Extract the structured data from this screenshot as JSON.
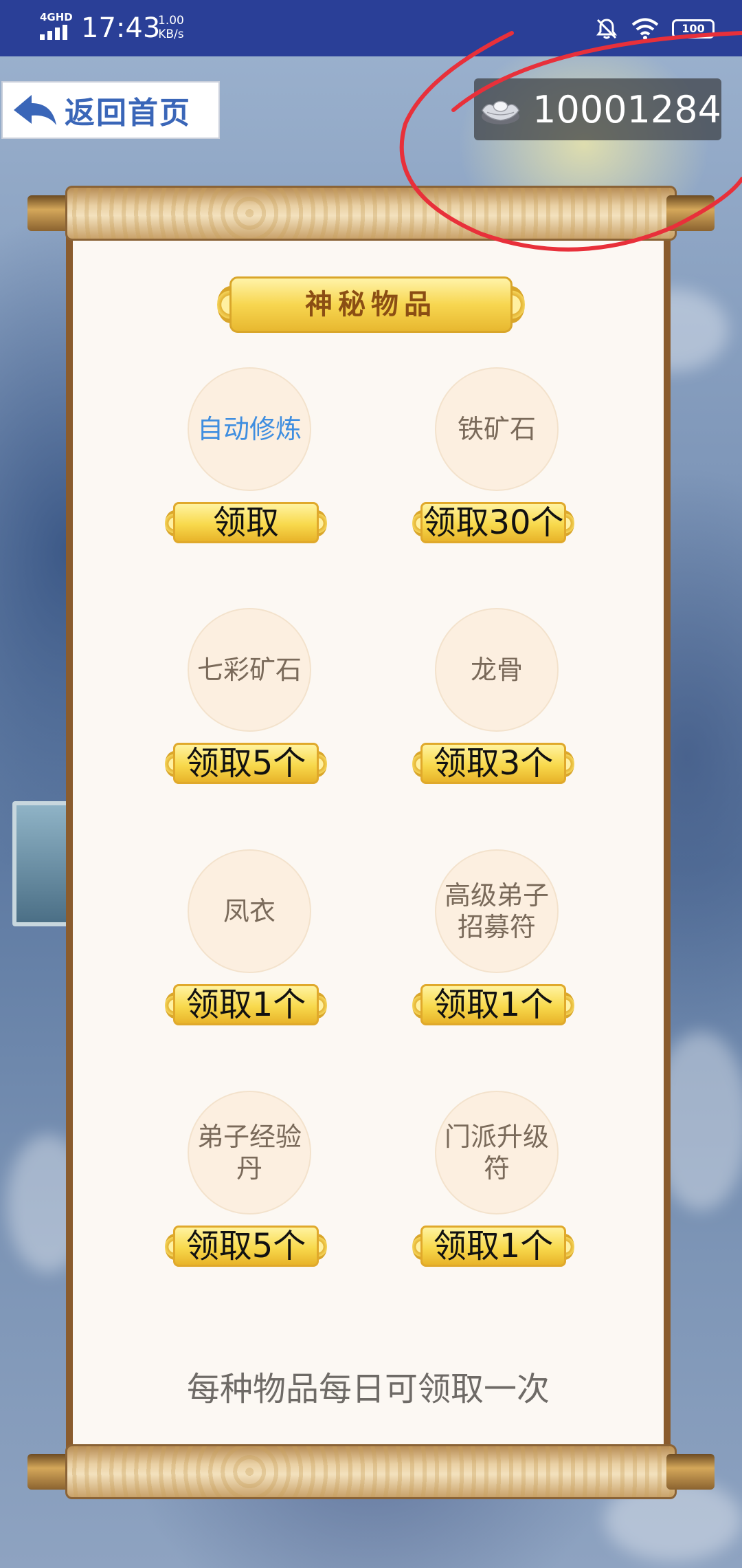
{
  "status_bar": {
    "network": "4GHD",
    "time": "17:43",
    "speed_value": "1.00",
    "speed_unit": "KB/s",
    "battery": "100"
  },
  "header": {
    "back_label": "返回首页",
    "currency_value": "10001284",
    "currency_icon": "silver-ingot-icon"
  },
  "panel": {
    "title": "神秘物品",
    "items": [
      {
        "name": "自动修炼",
        "claim_label": "领取",
        "highlighted": true
      },
      {
        "name": "铁矿石",
        "claim_label": "领取30个"
      },
      {
        "name": "七彩矿石",
        "claim_label": "领取5个"
      },
      {
        "name": "龙骨",
        "claim_label": "领取3个"
      },
      {
        "name": "凤衣",
        "claim_label": "领取1个"
      },
      {
        "name": "高级弟子招募符",
        "claim_label": "领取1个"
      },
      {
        "name": "弟子经验丹",
        "claim_label": "领取5个"
      },
      {
        "name": "门派升级符",
        "claim_label": "领取1个"
      }
    ],
    "footer_note": "每种物品每日可领取一次"
  },
  "colors": {
    "status_bar": "#2a3f97",
    "accent_blue": "#3f8ee0",
    "gold": "#f8d94c",
    "annotation_red": "#e8303a"
  }
}
